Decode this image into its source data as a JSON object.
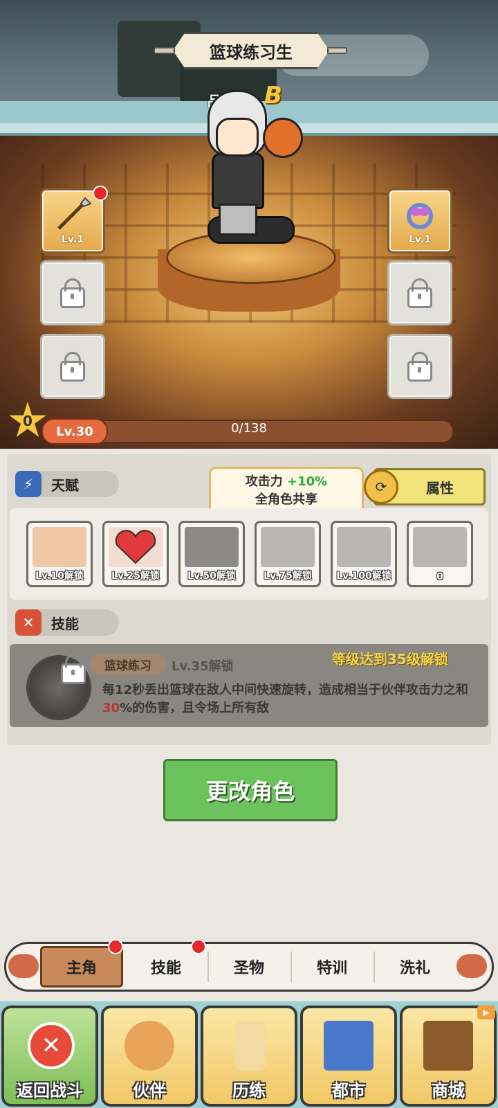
{
  "character": {
    "name": "篮球练习生",
    "quality_label": "品质:",
    "quality_grade": "B",
    "level": "Lv.30",
    "exp": "0/138",
    "stars": "0"
  },
  "equipment": {
    "left_slot_level": "Lv.1",
    "right_slot_level": "Lv.1"
  },
  "talent": {
    "section_title": "天赋",
    "attr_button": "属性",
    "tooltip_line1_prefix": "攻击力",
    "tooltip_line1_value": "+10%",
    "tooltip_line2": "全角色共享",
    "items": [
      {
        "label": "Lv.10解锁"
      },
      {
        "label": "Lv.25解锁"
      },
      {
        "label": "Lv.50解锁"
      },
      {
        "label": "Lv.75解锁"
      },
      {
        "label": "Lv.100解锁"
      },
      {
        "label": "0"
      }
    ]
  },
  "skill": {
    "section_title": "技能",
    "name": "篮球练习",
    "unlock_level": "Lv.35解锁",
    "requirement": "等级达到35级解锁",
    "desc_before": "每12秒丢出篮球在敌人中间快速旋转，造成相当于伙伴攻击力之和",
    "desc_highlight": "30",
    "desc_after": "%的伤害，且令场上所有敌"
  },
  "change_button": "更改角色",
  "sub_tabs": [
    "主角",
    "技能",
    "圣物",
    "特训",
    "洗礼"
  ],
  "bottom_nav": [
    "返回战斗",
    "伙伴",
    "历练",
    "都市",
    "商城"
  ],
  "colors": {
    "accent_green": "#6cc35e",
    "tab_active": "#c88a5a",
    "nav_bg": "#9ed0d4",
    "gold": "#f7c740"
  }
}
